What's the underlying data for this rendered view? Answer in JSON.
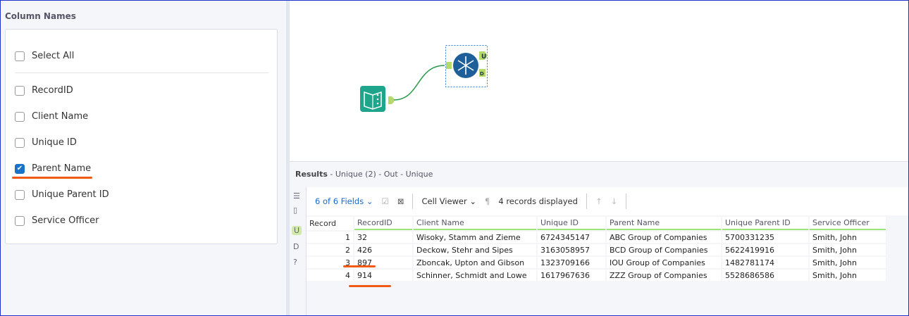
{
  "column_panel": {
    "title": "Column Names",
    "select_all": "Select All",
    "columns": [
      {
        "label": "RecordID",
        "checked": false
      },
      {
        "label": "Client Name",
        "checked": false
      },
      {
        "label": "Unique ID",
        "checked": false
      },
      {
        "label": "Parent Name",
        "checked": true
      },
      {
        "label": "Unique Parent ID",
        "checked": false
      },
      {
        "label": "Service Officer",
        "checked": false
      }
    ]
  },
  "workflow": {
    "unique_tool_anchors": {
      "u": "U",
      "d": "D"
    }
  },
  "results": {
    "title": "Results",
    "subtitle": " - Unique (2) - Out - Unique",
    "toolbar": {
      "fields": "6 of 6 Fields",
      "cell_viewer": "Cell Viewer",
      "records": "4 records displayed"
    },
    "side_icons": {
      "u": "U",
      "d": "D",
      "help": "?"
    },
    "headers": [
      "Record",
      "RecordID",
      "Client Name",
      "Unique ID",
      "Parent Name",
      "Unique Parent ID",
      "Service Officer"
    ],
    "rows": [
      [
        "1",
        "32",
        "Wisoky, Stamm and Zieme",
        "6724345147",
        "ABC Group of Companies",
        "5700331235",
        "Smith, John"
      ],
      [
        "2",
        "426",
        "Deckow, Stehr and Sipes",
        "3163058957",
        "BCD Group of Companies",
        "5622419916",
        "Smith, John"
      ],
      [
        "3",
        "897",
        "Zboncak, Upton and Gibson",
        "1323709166",
        "IOU Group of Companies",
        "1482781174",
        "Smith, John"
      ],
      [
        "4",
        "914",
        "Schinner, Schmidt and Lowe",
        "1617967636",
        "ZZZ Group of Companies",
        "5528686586",
        "Smith, John"
      ]
    ]
  }
}
